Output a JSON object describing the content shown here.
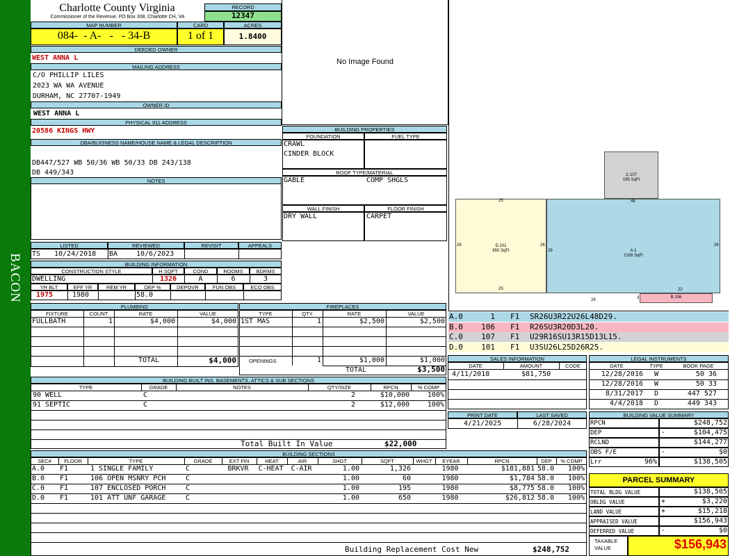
{
  "sidebar": {
    "district": "BACON"
  },
  "header": {
    "county": "Charlotte County Virginia",
    "subtitle": "Commissioner of the Revenue, PO Box 308, Charlotte CH, VA",
    "record_label": "RECORD",
    "record": "12347",
    "map_number_label": "MAP NUMBER",
    "map_number": "084-  - A-   -   - 34-B",
    "card_label": "CARD",
    "card": "1 of 1",
    "acres_label": "ACRES",
    "acres": "1.8400"
  },
  "owner": {
    "deeded_label": "DEEDED OWNER",
    "deeded_owner": "WEST ANNA L",
    "mailing_label": "MAILING ADDRESS",
    "mailing": [
      "C/O PHILLIP LILES",
      "2023 WA WA AVENUE",
      "DURHAM, NC 27707-1949"
    ],
    "owner_id_label": "OWNER ID",
    "owner_id": "WEST ANNA L",
    "physical_label": "PHYSICAL 911 ADDRESS",
    "physical": "20586 KINGS HWY",
    "dba_label": "DBA/BUISNESS NAME/HOUSE NAME & LEGAL DESCRIPTION",
    "legal": [
      "DB447/527 WB 50/36 WB 50/33 DB 243/138",
      "DB 449/343"
    ],
    "notes_label": "NOTES"
  },
  "photo": {
    "text": "No Image Found"
  },
  "building_properties": {
    "label": "BUILDING PROPERTIES",
    "foundation_label": "FOUNDATION",
    "foundation": [
      "CRAWL",
      "CINDER BLOCK"
    ],
    "fuel_label": "FUEL TYPE",
    "roof_label": "ROOF TYPE/MATERIAL",
    "roof_type": "GABLE",
    "roof_material": "COMP SHGLS",
    "wall_label": "WALL FINISH",
    "wall": "DRY WALL",
    "floor_label": "FLOOR FINISH",
    "floor": "CARPET"
  },
  "review": {
    "listed_label": "LISTED",
    "reviewed_label": "REVIEWED",
    "revisit_label": "REVISIT",
    "appeals_label": "APPEALS",
    "listed_by": "TS",
    "listed_date": "10/24/2018",
    "reviewed_by": "BA",
    "reviewed_date": "10/6/2023"
  },
  "building_info": {
    "label": "BUILDING INFORMATION",
    "style_label": "CONSTRUCTION STYLE",
    "hsqft_label": "H SQFT",
    "cond_label": "COND",
    "rooms_label": "ROOMS",
    "bdrms_label": "BDRMS",
    "style": "DWELLING",
    "hsqft": "1326",
    "cond": "A",
    "rooms": "6",
    "bdrms": "3",
    "yrblt_label": "YR BLT",
    "effyr_label": "EFF YR",
    "remyr_label": "REM YR",
    "dep_label": "DEP %",
    "depovr_label": "DEPOVR",
    "funobs_label": "FUN OBS",
    "ecoobs_label": "ECO OBS",
    "yrblt": "1975",
    "effyr": "1980",
    "dep": "58.0"
  },
  "plumbing": {
    "label": "PLUMBING",
    "headers": [
      "FIXTURE",
      "COUNT",
      "RATE",
      "VALUE"
    ],
    "rows": [
      [
        "FULLBATH",
        "1",
        "$4,000",
        "$4,000"
      ]
    ],
    "total_label": "TOTAL",
    "total": "$4,000"
  },
  "fireplaces": {
    "label": "FIREPLACES",
    "headers": [
      "TYPE",
      "QTY",
      "RATE",
      "VALUE"
    ],
    "rows": [
      [
        "1ST MAS",
        "1",
        "$2,500",
        "$2,500"
      ]
    ],
    "openings_label": "OPENINGS",
    "openings": [
      "1",
      "$1,000",
      "$1,000"
    ],
    "total_label": "TOTAL",
    "total": "$3,500"
  },
  "sketch": {
    "labels": {
      "c107": "C.107",
      "c107_sqft": "195 SqFt",
      "d101": "D.101",
      "d101_sqft": "650 SqFt",
      "a1": "A.1",
      "a1_sqft": "1326 SqFt",
      "b106": "B.106"
    },
    "dims": {
      "d_top": "25",
      "d_bot": "25",
      "d_left": "26",
      "d_right": "26",
      "a_top": "48",
      "a_left": "29",
      "a_right": "26",
      "a_bot1": "28",
      "a_bot2": "3",
      "a_bot3": "22"
    }
  },
  "segments": [
    {
      "code": "A.0",
      "n": "1",
      "f": "F1",
      "path": "SR26U3R22U26L48D29.",
      "color": "#add8e6"
    },
    {
      "code": "B.0",
      "n": "106",
      "f": "F1",
      "path": "R26SU3R20D3L20.",
      "color": "#f7b6c2"
    },
    {
      "code": "C.0",
      "n": "107",
      "f": "F1",
      "path": "U29R16SU13R15D13L15.",
      "color": "#d3d3d3"
    },
    {
      "code": "D.0",
      "n": "101",
      "f": "F1",
      "path": "U3SU26L25D26R25.",
      "color": "#fffbd6"
    }
  ],
  "sales": {
    "label": "SALES INFORMATION",
    "headers": [
      "DATE",
      "AMOUNT",
      "CODE"
    ],
    "rows": [
      [
        "4/11/2018",
        "$81,750",
        ""
      ]
    ]
  },
  "legal_instruments": {
    "label": "LEGAL INSTRUMENTS",
    "headers": [
      "DATE",
      "TYPE",
      "BOOK PAGE"
    ],
    "rows": [
      [
        "12/28/2016",
        "W",
        "50 36"
      ],
      [
        "12/28/2016",
        "W",
        "50 33"
      ],
      [
        "8/31/2017",
        "D",
        "447 527"
      ],
      [
        "4/4/2018",
        "D",
        "449 343"
      ]
    ]
  },
  "print": {
    "print_label": "PRINT DATE",
    "print_date": "4/21/2025",
    "saved_label": "LAST SAVED",
    "saved_date": "6/28/2024"
  },
  "value_summary": {
    "label": "BUILDING VALUE SUMMARY",
    "rows": [
      [
        "RPCN",
        "",
        "",
        "$248,752"
      ],
      [
        "DEP",
        "",
        "-",
        "$104,475"
      ],
      [
        "RCLND",
        "",
        "",
        "$144,277"
      ],
      [
        "OBS F/E",
        "",
        "-",
        "$0"
      ],
      [
        "Lrr",
        "96%",
        "",
        "$138,505"
      ]
    ]
  },
  "parcel_summary": {
    "label": "PARCEL SUMMARY",
    "rows": [
      [
        "TOTAL BLDG VALUE",
        "",
        "$138,505"
      ],
      [
        "OBLDG VALUE",
        "+",
        "$3,220"
      ],
      [
        "LAND VALUE",
        "+",
        "$15,218"
      ],
      [
        "APPRAISED VALUE",
        "",
        "$156,943"
      ],
      [
        "DEFERRED VALUE",
        "-",
        "$0"
      ]
    ],
    "taxable_label": "TAXABLE VALUE",
    "taxable": "$156,943"
  },
  "built_ins": {
    "label": "BUILDING BUILT INS, BASEMENTS, ATTICS & SUB SECTIONS",
    "headers": [
      "TYPE",
      "GRADE",
      "NOTES",
      "QTY/SIZE",
      "RPCN",
      "% COMP"
    ],
    "rows": [
      [
        "90 WELL",
        "C",
        "",
        "2",
        "$10,000",
        "100%"
      ],
      [
        "91 SEPTIC",
        "C",
        "",
        "2",
        "$12,000",
        "100%"
      ]
    ],
    "total_label": "Total Built In Value",
    "total": "$22,000"
  },
  "sections": {
    "label": "BUILDING SECTIONS",
    "headers": [
      "SEC#",
      "FLOOR",
      "TYPE",
      "GRADE",
      "EXT FIN",
      "HEAT",
      "AIR",
      "SHGT",
      "SQFT",
      "WHGT",
      "EYEAR",
      "RPCN",
      "DEP",
      "% COMP"
    ],
    "rows": [
      [
        "A.0",
        "F1",
        "1 SINGLE FAMILY",
        "C",
        "BRKVR",
        "C-HEAT",
        "C-AIR",
        "1.00",
        "1,326",
        "",
        "1980",
        "$181,881",
        "58.0",
        "100%"
      ],
      [
        "B.0",
        "F1",
        "106 OPEN MSNRY PCH",
        "C",
        "",
        "",
        "",
        "1.00",
        "60",
        "",
        "1980",
        "$1,784",
        "58.0",
        "100%"
      ],
      [
        "C.0",
        "F1",
        "107 ENCLOSED PORCH",
        "C",
        "",
        "",
        "",
        "1.00",
        "195",
        "",
        "1980",
        "$8,775",
        "58.0",
        "100%"
      ],
      [
        "D.0",
        "F1",
        "101 ATT UNF GARAGE",
        "C",
        "",
        "",
        "",
        "1.00",
        "650",
        "",
        "1980",
        "$26,812",
        "58.0",
        "100%"
      ]
    ],
    "rcn_label": "Building Replacement Cost New",
    "rcn": "$248,752"
  }
}
